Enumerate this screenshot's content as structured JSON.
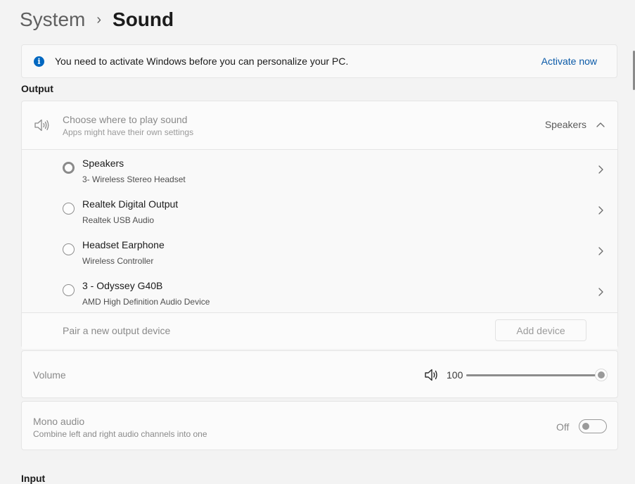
{
  "breadcrumb": {
    "parent": "System",
    "separator": "›",
    "current": "Sound"
  },
  "banner": {
    "icon": "info-icon",
    "message": "You need to activate Windows before you can personalize your PC.",
    "link": "Activate now",
    "accent_color": "#0067c0"
  },
  "output": {
    "section_label": "Output",
    "header": {
      "icon": "speaker-icon",
      "title": "Choose where to play sound",
      "subtitle": "Apps might have their own settings",
      "current_value": "Speakers",
      "expanded": true
    },
    "devices": [
      {
        "name": "Speakers",
        "detail": "3- Wireless Stereo Headset",
        "selected": true
      },
      {
        "name": "Realtek Digital Output",
        "detail": "Realtek USB Audio",
        "selected": false
      },
      {
        "name": "Headset Earphone",
        "detail": "Wireless Controller",
        "selected": false
      },
      {
        "name": "3 - Odyssey G40B",
        "detail": "AMD High Definition Audio Device",
        "selected": false
      }
    ],
    "pair": {
      "label": "Pair a new output device",
      "button": "Add device"
    }
  },
  "volume": {
    "label": "Volume",
    "value": "100",
    "level": 1.0,
    "icon": "volume-icon"
  },
  "mono_audio": {
    "title": "Mono audio",
    "subtitle": "Combine left and right audio channels into one",
    "state": "Off",
    "on": false
  },
  "next_section_label": "Input"
}
